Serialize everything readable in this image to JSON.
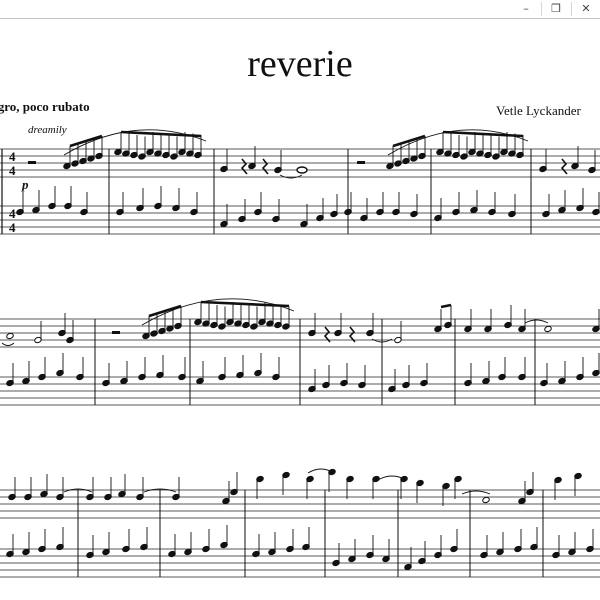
{
  "window": {
    "controls": [
      {
        "name": "minimize-button",
        "glyph": "–"
      },
      {
        "name": "restore-button",
        "glyph": "❐"
      },
      {
        "name": "close-button",
        "glyph": "✕"
      }
    ]
  },
  "score": {
    "title": "reverie",
    "tempo": "egro, poco rubato",
    "composer": "Vetle Lyckander",
    "expression": "dreamily",
    "dynamic": "p"
  },
  "colors": {
    "ink": "#111111",
    "staff": "#222222",
    "background": "#ffffff"
  }
}
